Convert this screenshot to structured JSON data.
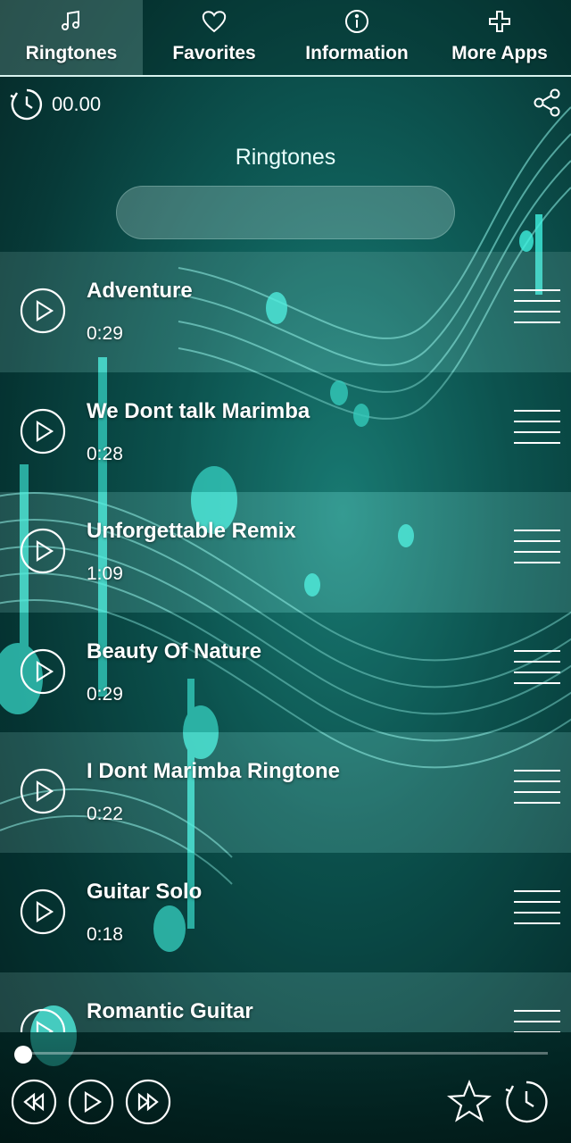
{
  "tabs": [
    {
      "label": "Ringtones",
      "icon": "music-note-icon",
      "active": true
    },
    {
      "label": "Favorites",
      "icon": "heart-icon",
      "active": false
    },
    {
      "label": "Information",
      "icon": "info-icon",
      "active": false
    },
    {
      "label": "More Apps",
      "icon": "plus-icon",
      "active": false
    }
  ],
  "header": {
    "time": "00.00",
    "section_title": "Ringtones"
  },
  "search": {
    "value": ""
  },
  "ringtones": [
    {
      "name": "Adventure",
      "duration": "0:29"
    },
    {
      "name": "We Dont talk Marimba",
      "duration": "0:28"
    },
    {
      "name": "Unforgettable Remix",
      "duration": "1:09"
    },
    {
      "name": "Beauty Of Nature",
      "duration": "0:29"
    },
    {
      "name": "I Dont Marimba Ringtone",
      "duration": "0:22"
    },
    {
      "name": "Guitar Solo",
      "duration": "0:18"
    },
    {
      "name": "Romantic Guitar",
      "duration": ""
    }
  ],
  "player": {
    "progress": 0
  },
  "colors": {
    "background": "#0f5f5a",
    "accent": "#2ee6d6",
    "text": "#ffffff"
  }
}
